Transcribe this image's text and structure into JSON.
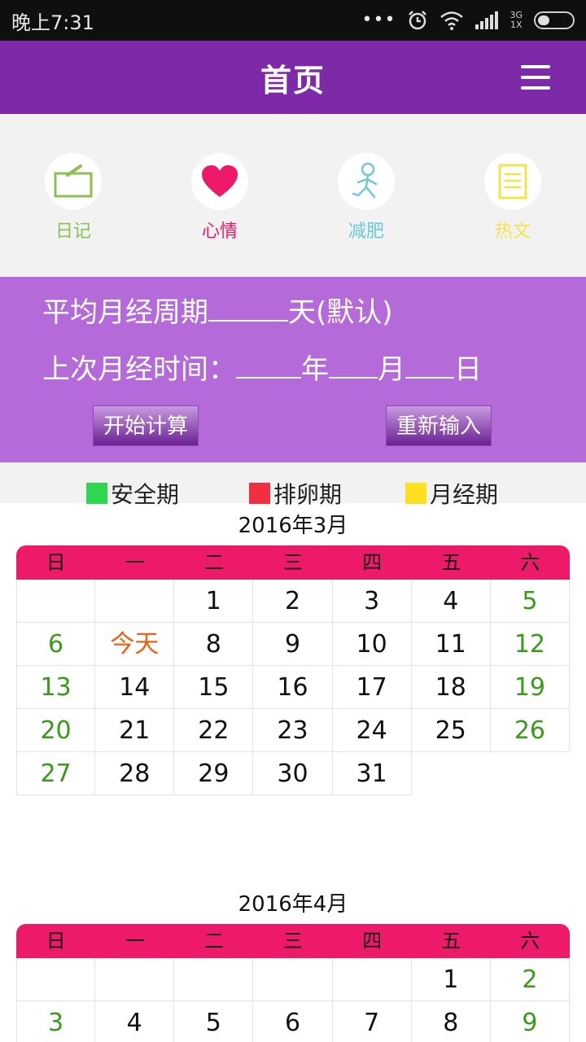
{
  "status_bar": {
    "time": "晚上7:31",
    "network_top": "3G",
    "network_bottom": "1X",
    "battery_level": 0.35
  },
  "app_bar": {
    "title": "首页"
  },
  "shortcuts": [
    {
      "label": "日记",
      "icon": "notebook-icon",
      "color": "#8cc152"
    },
    {
      "label": "心情",
      "icon": "heart-icon",
      "color": "#ec1a68"
    },
    {
      "label": "减肥",
      "icon": "running-person-icon",
      "color": "#6cc8d8"
    },
    {
      "label": "热文",
      "icon": "document-icon",
      "color": "#f4e34a"
    }
  ],
  "calculator": {
    "cycle_prefix": "平均月经周期",
    "cycle_suffix": "天(默认)",
    "last_prefix": "上次月经时间：",
    "year_unit": "年",
    "month_unit": "月",
    "day_unit": "日",
    "start_button": "开始计算",
    "reset_button": "重新输入"
  },
  "legend": [
    {
      "label": "安全期",
      "color": "#2fd64f"
    },
    {
      "label": "排卵期",
      "color": "#f03040"
    },
    {
      "label": "月经期",
      "color": "#ffe020"
    }
  ],
  "weekdays": [
    "日",
    "一",
    "二",
    "三",
    "四",
    "五",
    "六"
  ],
  "colors": {
    "primary": "#7e2aa8",
    "panel": "#b56ad9",
    "calendar_header": "#ec1a68",
    "weekend": "#3a9a1a",
    "today": "#f06010"
  },
  "months": [
    {
      "title": "2016年3月",
      "cells": [
        "",
        "",
        "1",
        "2",
        "3",
        "4",
        "5",
        "6",
        "今天",
        "8",
        "9",
        "10",
        "11",
        "12",
        "13",
        "14",
        "15",
        "16",
        "17",
        "18",
        "19",
        "20",
        "21",
        "22",
        "23",
        "24",
        "25",
        "26",
        "27",
        "28",
        "29",
        "30",
        "31"
      ]
    },
    {
      "title": "2016年4月",
      "cells": [
        "",
        "",
        "",
        "",
        "",
        "1",
        "2",
        "3",
        "4",
        "5",
        "6",
        "7",
        "8",
        "9"
      ]
    }
  ]
}
